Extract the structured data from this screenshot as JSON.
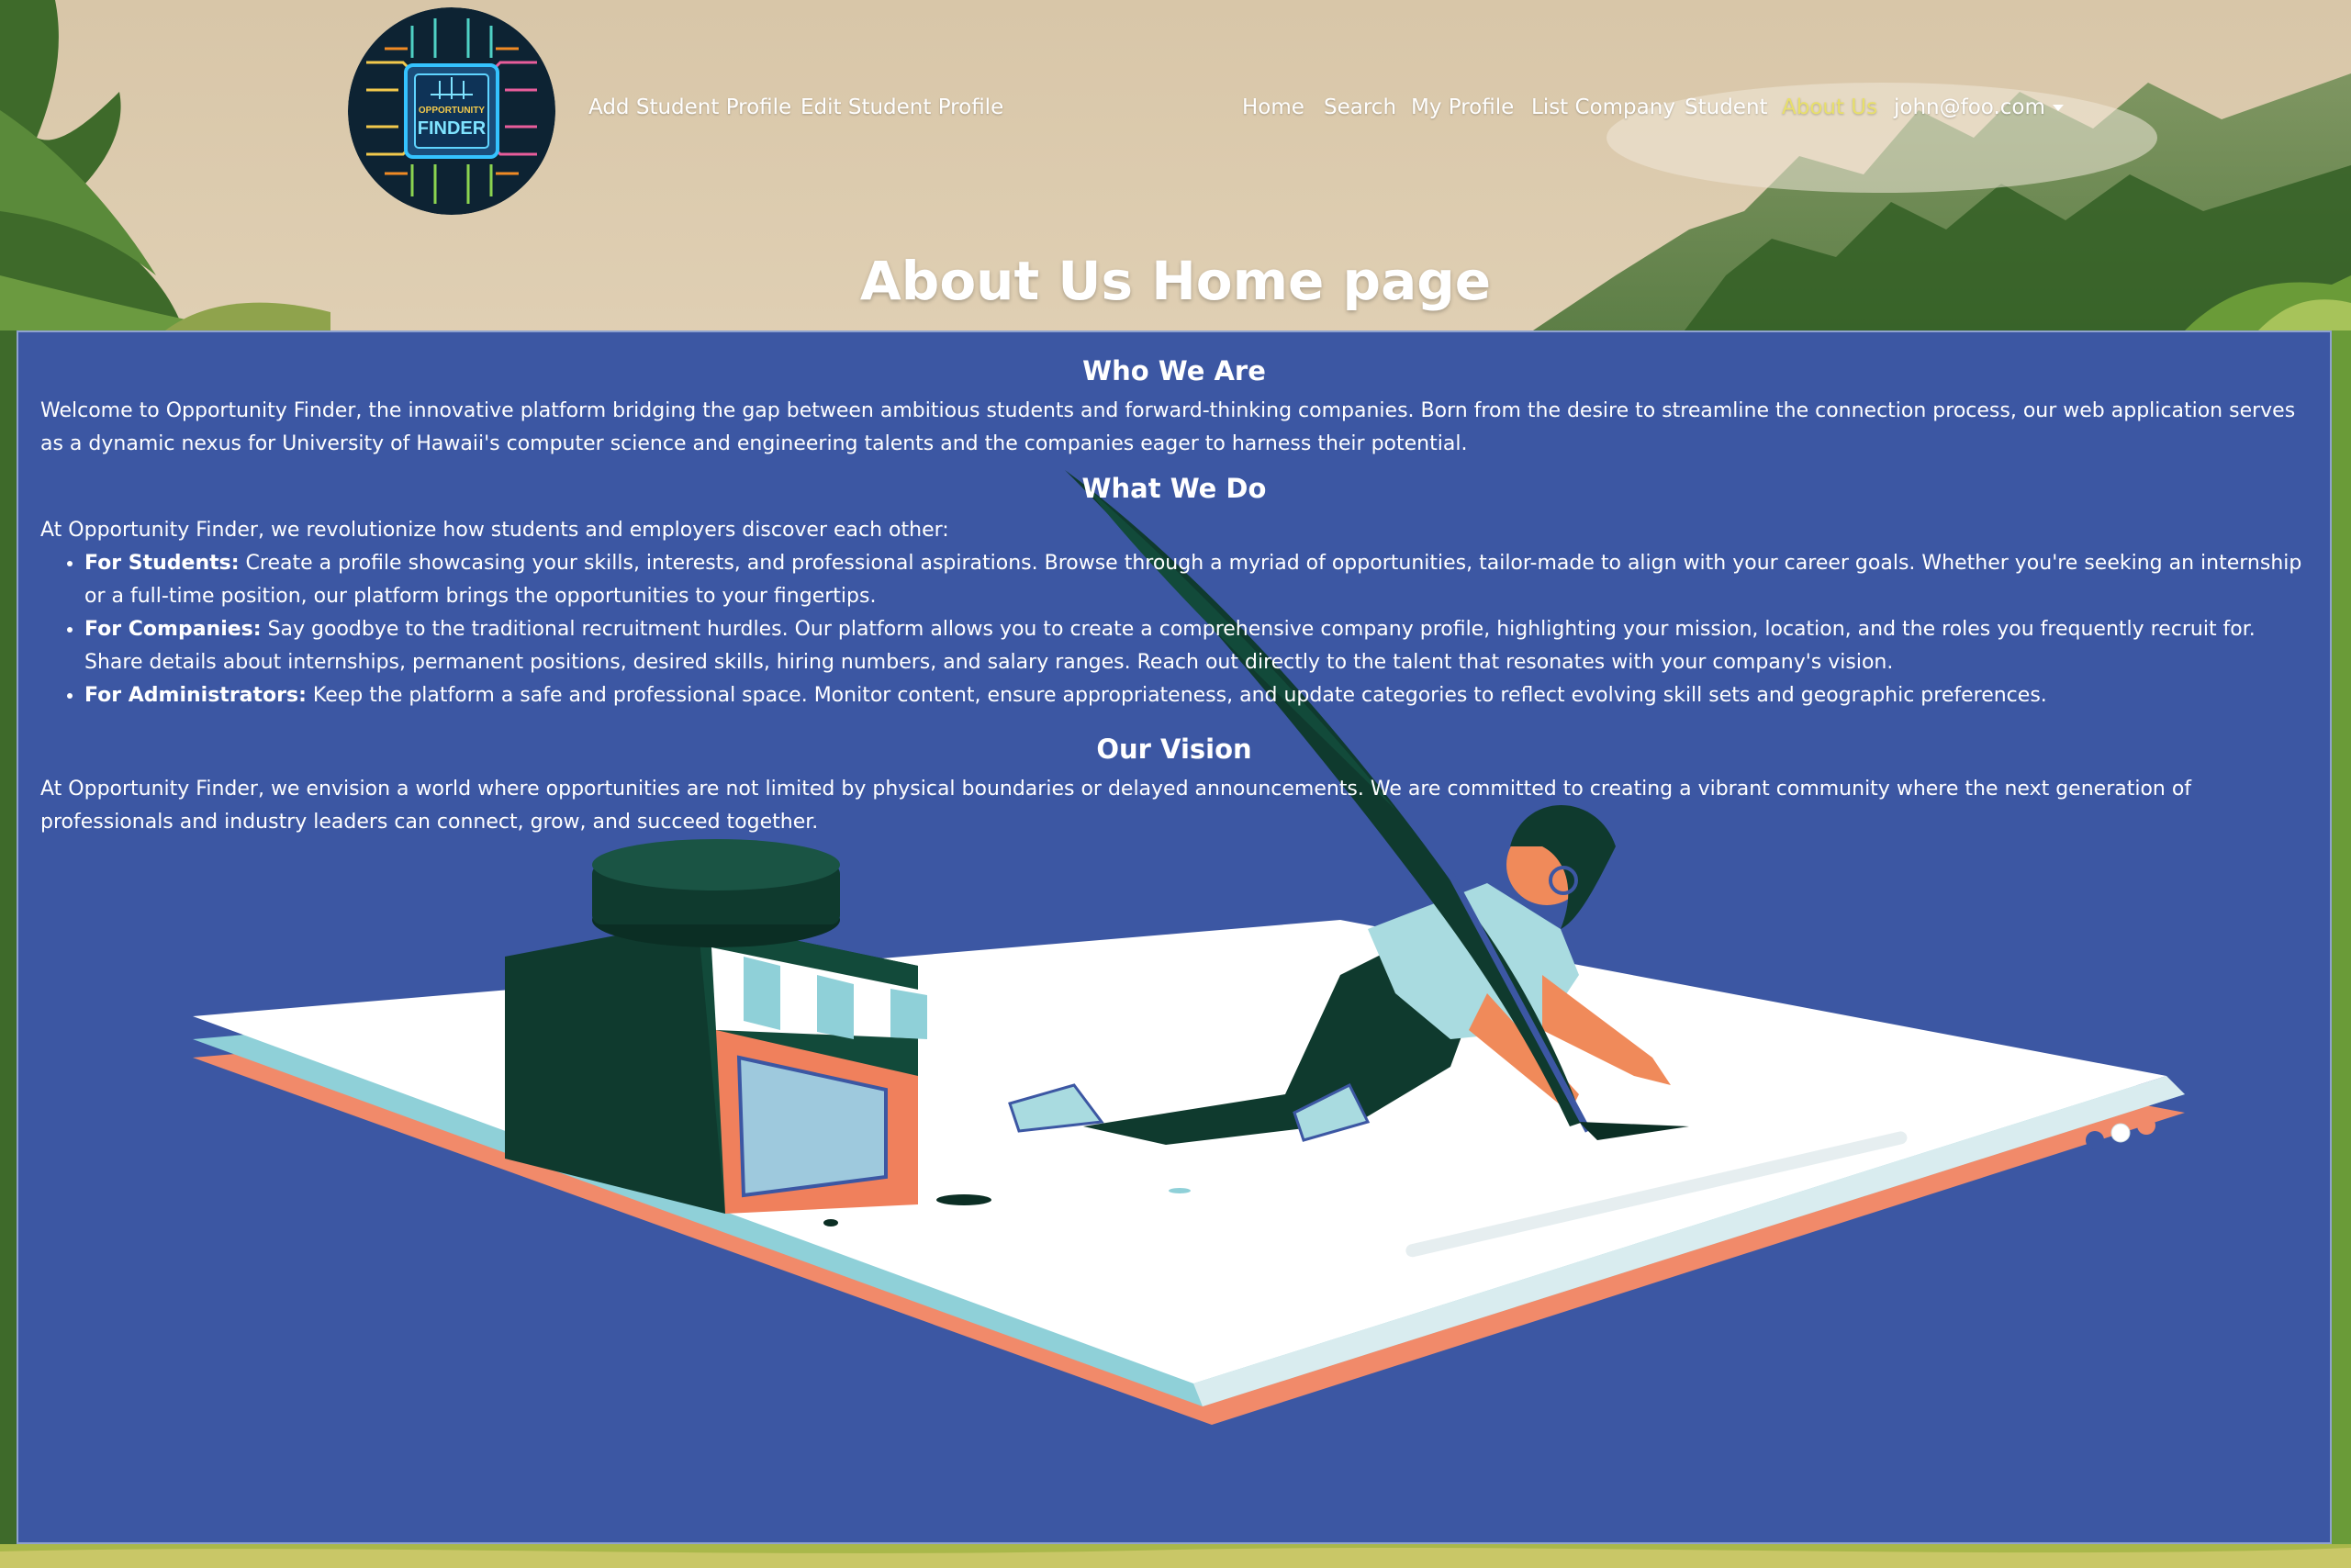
{
  "nav": {
    "logo_alt": "Opportunity Finder logo",
    "logo_text_top": "OPPORTUNITY",
    "logo_text_bottom": "FINDER",
    "left_links": [
      "Add Student Profile",
      "Edit Student Profile"
    ],
    "right_links": [
      "Home",
      "Search",
      "My Profile",
      "List Company",
      "Student",
      "About Us"
    ],
    "active_link": "About Us",
    "user_menu": "john@foo.com"
  },
  "page_title": "About Us Home page",
  "sections": {
    "who": {
      "heading": "Who We Are",
      "body": "Welcome to Opportunity Finder, the innovative platform bridging the gap between ambitious students and forward-thinking companies. Born from the desire to streamline the connection process, our web application serves as a dynamic nexus for University of Hawaii's computer science and engineering talents and the companies eager to harness their potential."
    },
    "what": {
      "heading": "What We Do",
      "intro": "At Opportunity Finder, we revolutionize how students and employers discover each other:",
      "items": [
        {
          "label": "For Students:",
          "text": " Create a profile showcasing your skills, interests, and professional aspirations. Browse through a myriad of opportunities, tailor-made to align with your career goals. Whether you're seeking an internship or a full-time position, our platform brings the opportunities to your fingertips."
        },
        {
          "label": "For Companies:",
          "text": " Say goodbye to the traditional recruitment hurdles. Our platform allows you to create a comprehensive company profile, highlighting your mission, location, and the roles you frequently recruit for. Share details about internships, permanent positions, desired skills, hiring numbers, and salary ranges. Reach out directly to the talent that resonates with your company's vision."
        },
        {
          "label": "For Administrators:",
          "text": " Keep the platform a safe and professional space. Monitor content, ensure appropriateness, and update categories to reflect evolving skill sets and geographic preferences."
        }
      ]
    },
    "vision": {
      "heading": "Our Vision",
      "body": "At Opportunity Finder, we envision a world where opportunities are not limited by physical boundaries or delayed announcements. We are committed to creating a vibrant community where the next generation of professionals and industry leaders can connect, grow, and succeed together."
    }
  },
  "colors": {
    "panel": "#3c57a3",
    "active_link": "#e8e06a",
    "text": "#ffffff"
  }
}
